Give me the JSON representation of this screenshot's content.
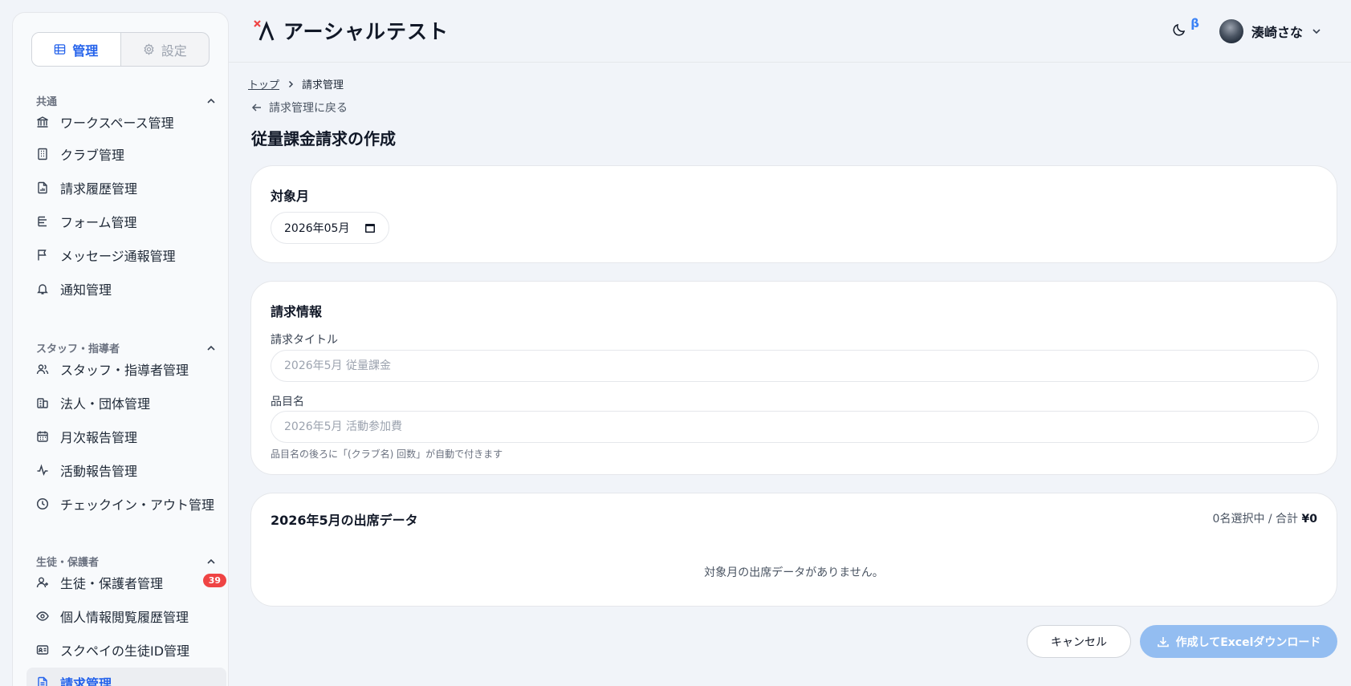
{
  "sidebar": {
    "mode_tabs": [
      {
        "label": "管理",
        "icon": "grid-icon",
        "active": true
      },
      {
        "label": "設定",
        "icon": "gear-icon",
        "active": false
      }
    ],
    "sections": [
      {
        "title": "共通",
        "items": [
          {
            "label": "ワークスペース管理",
            "icon": "bank-icon"
          },
          {
            "label": "クラブ管理",
            "icon": "building-icon"
          },
          {
            "label": "請求履歴管理",
            "icon": "file-chart-icon"
          },
          {
            "label": "フォーム管理",
            "icon": "form-icon"
          },
          {
            "label": "メッセージ通報管理",
            "icon": "flag-icon"
          },
          {
            "label": "通知管理",
            "icon": "bell-icon"
          }
        ]
      },
      {
        "title": "スタッフ・指導者",
        "items": [
          {
            "label": "スタッフ・指導者管理",
            "icon": "users-icon"
          },
          {
            "label": "法人・団体管理",
            "icon": "buildings-icon"
          },
          {
            "label": "月次報告管理",
            "icon": "calendar-icon"
          },
          {
            "label": "活動報告管理",
            "icon": "activity-icon"
          },
          {
            "label": "チェックイン・アウト管理",
            "icon": "clock-icon"
          }
        ]
      },
      {
        "title": "生徒・保護者",
        "items": [
          {
            "label": "生徒・保護者管理",
            "icon": "user-plus-icon",
            "badge": "39"
          },
          {
            "label": "個人情報閲覧履歴管理",
            "icon": "eye-icon"
          },
          {
            "label": "スクペイの生徒ID管理",
            "icon": "id-card-icon"
          },
          {
            "label": "請求管理",
            "icon": "invoice-icon",
            "active": true
          }
        ]
      }
    ]
  },
  "header": {
    "title": "アーシャルテスト",
    "beta": "β",
    "user_name": "湊崎さな"
  },
  "breadcrumb": {
    "home": "トップ",
    "current": "請求管理"
  },
  "back_link": "請求管理に戻る",
  "page_title": "従量課金請求の作成",
  "target_month": {
    "title": "対象月",
    "value": "2026年05月"
  },
  "billing_info": {
    "title": "請求情報",
    "title_label": "請求タイトル",
    "title_placeholder": "2026年5月 従量課金",
    "item_label": "品目名",
    "item_placeholder": "2026年5月 活動参加費",
    "item_hint": "品目名の後ろに「(クラブ名) 回数」が自動で付きます"
  },
  "attendance": {
    "title": "2026年5月の出席データ",
    "summary_prefix": "0名選択中 / 合計 ",
    "summary_total": "¥0",
    "empty": "対象月の出席データがありません。"
  },
  "actions": {
    "cancel": "キャンセル",
    "submit": "作成してExcelダウンロード"
  },
  "colors": {
    "accent": "#2563eb",
    "primary_disabled": "#93bdf1",
    "badge": "#ef4444"
  }
}
